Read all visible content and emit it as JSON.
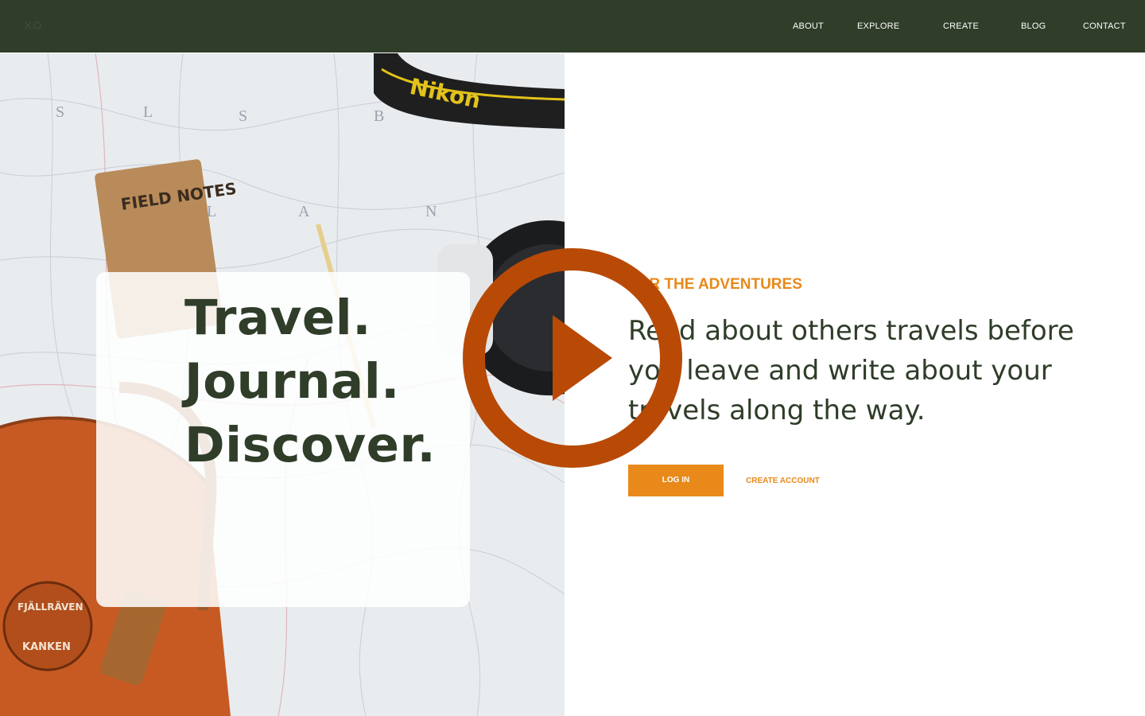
{
  "header": {
    "logo": "XO",
    "nav": [
      {
        "label": "ABOUT"
      },
      {
        "label": "EXPLORE"
      },
      {
        "label": "CREATE"
      },
      {
        "label": "BLOG"
      },
      {
        "label": "CONTACT"
      }
    ]
  },
  "hero": {
    "lines": [
      "Travel.",
      "Journal.",
      "Discover."
    ],
    "image_items": {
      "notebook": "FIELD NOTES",
      "strap": "Nikon",
      "patch_top": "FJÄLLRÄVEN",
      "patch_bottom": "KANKEN"
    }
  },
  "main": {
    "eyebrow": "FOR THE ADVENTURES",
    "lead": "Read about others travels before you leave and write about your travels along the way.",
    "login_label": "LOG IN",
    "create_account_label": "CREATE ACCOUNT"
  },
  "overlay": {
    "icon": "play-icon"
  },
  "colors": {
    "nav_bg": "#2f3d29",
    "accent": "#e8891a",
    "text_dark": "#2f3d29",
    "play": "#b84a06"
  }
}
